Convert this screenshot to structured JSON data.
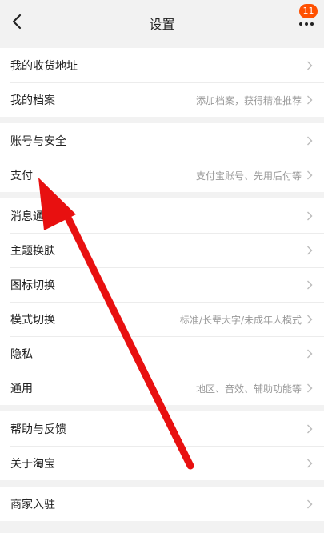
{
  "header": {
    "title": "设置",
    "badge_count": "11",
    "back_icon": "chevron-left-icon",
    "more_icon": "more-dots-icon"
  },
  "groups": [
    {
      "items": [
        {
          "label": "我的收货地址",
          "hint": ""
        },
        {
          "label": "我的档案",
          "hint": "添加档案，获得精准推荐"
        }
      ]
    },
    {
      "items": [
        {
          "label": "账号与安全",
          "hint": ""
        },
        {
          "label": "支付",
          "hint": "支付宝账号、先用后付等"
        }
      ]
    },
    {
      "items": [
        {
          "label": "消息通知",
          "hint": ""
        },
        {
          "label": "主题换肤",
          "hint": ""
        },
        {
          "label": "图标切换",
          "hint": ""
        },
        {
          "label": "模式切换",
          "hint": "标准/长辈大字/未成年人模式"
        },
        {
          "label": "隐私",
          "hint": ""
        },
        {
          "label": "通用",
          "hint": "地区、音效、辅助功能等"
        }
      ]
    },
    {
      "items": [
        {
          "label": "帮助与反馈",
          "hint": ""
        },
        {
          "label": "关于淘宝",
          "hint": ""
        }
      ]
    },
    {
      "items": [
        {
          "label": "商家入驻",
          "hint": ""
        }
      ]
    }
  ],
  "annotation": {
    "arrow_color": "#e81010",
    "points_to": "支付"
  },
  "colors": {
    "badge": "#ff5000",
    "background": "#f2f2f2"
  }
}
